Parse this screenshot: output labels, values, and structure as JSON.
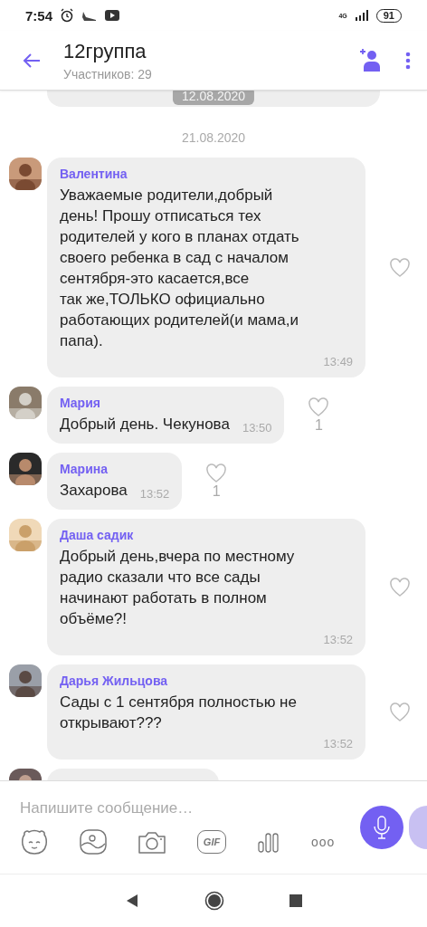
{
  "status_bar": {
    "time": "7:54",
    "network": "4G",
    "battery": "91"
  },
  "header": {
    "title": "12группа",
    "subtitle": "Участников: 29"
  },
  "earlier_date": "12.08.2020",
  "date_separator": "21.08.2020",
  "messages": [
    {
      "kind": "block",
      "sender": "Валентина",
      "text": "Уважаемые родители,добрый\nдень! Прошу отписаться тех\nродителей у кого в планах отдать\nсвоего ребенка в сад с началом\nсентября-это касается,все\nтак же,ТОЛЬКО официально\nработающих родителей(и мама,и\nпапа).",
      "time": "13:49"
    },
    {
      "kind": "inline",
      "sender": "Мария",
      "text": "Добрый день. Чекунова",
      "time": "13:50",
      "likes": "1"
    },
    {
      "kind": "inline",
      "sender": "Марина",
      "text": "Захарова",
      "time": "13:52",
      "likes": "1"
    },
    {
      "kind": "block",
      "sender": "Даша садик",
      "text": "Добрый день,вчера по местному\nрадио сказали что все сады\nначинают работать в полном\nобъёме?!",
      "time": "13:52"
    },
    {
      "kind": "block",
      "sender": "Дарья Жильцова",
      "text": "Сады с 1 сентября полностью не\nоткрывают???",
      "time": "13:52"
    }
  ],
  "composer": {
    "placeholder": "Напишите сообщение…",
    "gif_label": "GIF",
    "more_label": "ooo"
  }
}
